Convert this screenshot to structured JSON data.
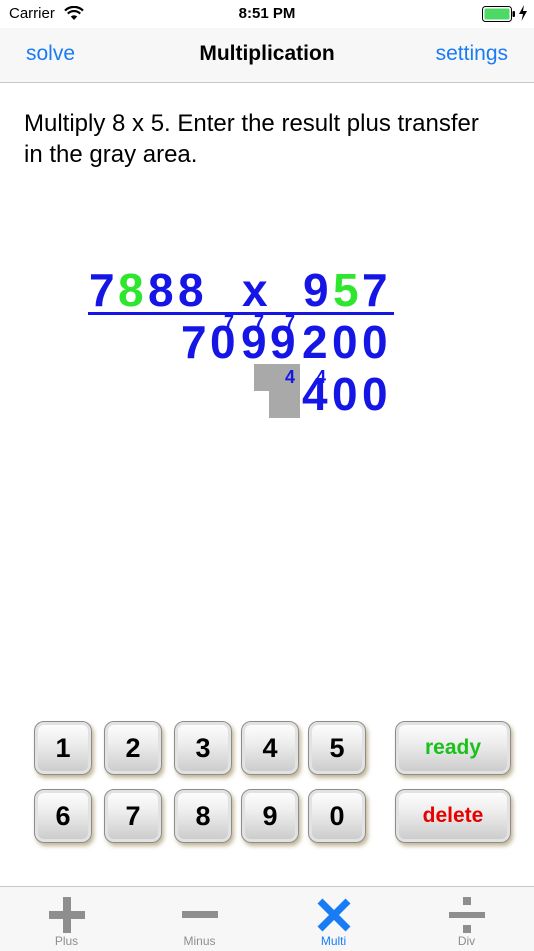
{
  "status_bar": {
    "carrier": "Carrier",
    "time": "8:51 PM",
    "wifi_icon": "wifi-icon",
    "battery_icon": "battery-icon",
    "charging_icon": "bolt-icon"
  },
  "nav": {
    "left_button": "solve",
    "title": "Multiplication",
    "right_button": "settings"
  },
  "instruction": "Multiply 8 x 5.  Enter the result plus transfer in the gray area.",
  "problem": {
    "multiplicand": [
      "7",
      "8",
      "8",
      "8"
    ],
    "operator": "x",
    "multiplier": [
      "9",
      "5",
      "7"
    ],
    "highlight_multiplicand_index": 1,
    "highlight_multiplier_index": 1,
    "highlight_color": "#2ee62e",
    "digit_color": "#1515e6",
    "partial_1": [
      "7",
      "0",
      "9",
      "9",
      "2",
      "0",
      "0"
    ],
    "partial_1_carries": [
      "7",
      "7",
      "7"
    ],
    "partial_2": [
      "4",
      "0",
      "0"
    ],
    "partial_2_carries": [
      "4",
      "4"
    ]
  },
  "keypad": {
    "row1": [
      "1",
      "2",
      "3",
      "4",
      "5"
    ],
    "row2": [
      "6",
      "7",
      "8",
      "9",
      "0"
    ],
    "ready": "ready",
    "delete": "delete",
    "ready_color": "#19c219",
    "delete_color": "#e60000"
  },
  "tabs": [
    {
      "label": "Plus",
      "icon": "plus-icon",
      "active": false
    },
    {
      "label": "Minus",
      "icon": "minus-icon",
      "active": false
    },
    {
      "label": "Multi",
      "icon": "multiply-icon",
      "active": true
    },
    {
      "label": "Div",
      "icon": "divide-icon",
      "active": false
    }
  ],
  "colors": {
    "accent": "#1a7cf5",
    "tab_inactive": "#8e8e8e",
    "gray_area": "#a9a9a9"
  }
}
